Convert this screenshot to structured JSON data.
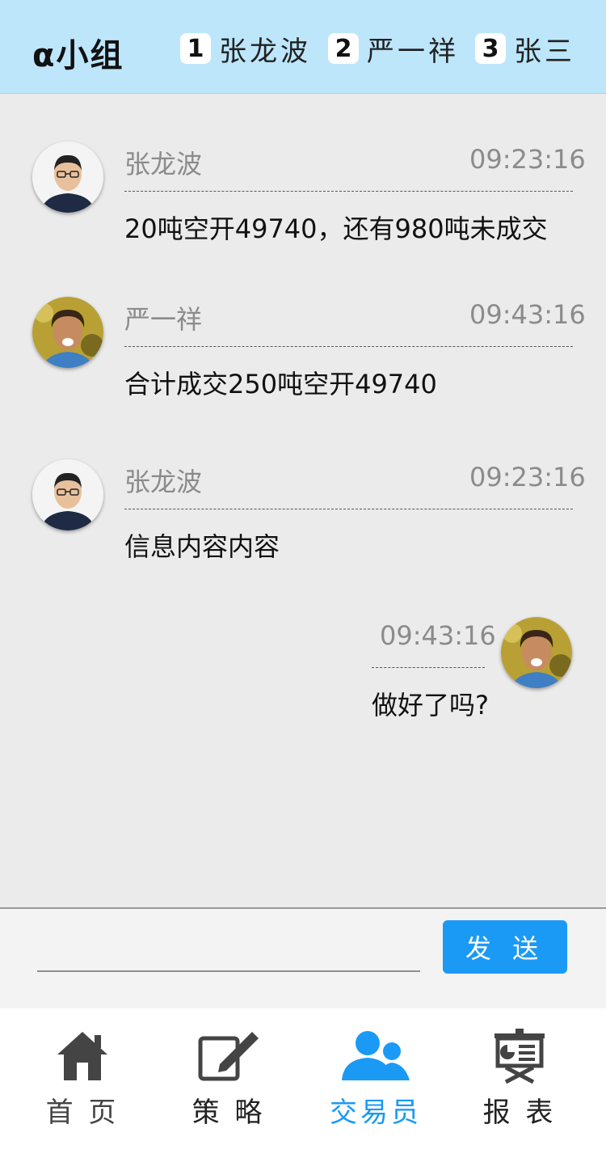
{
  "header": {
    "title": "α小组",
    "members": [
      {
        "rank": "1",
        "name": "张龙波"
      },
      {
        "rank": "2",
        "name": "严一祥"
      },
      {
        "rank": "3",
        "name": "张三"
      }
    ]
  },
  "messages": [
    {
      "sender": "张龙波",
      "time": "09:23:16",
      "text": "20吨空开49740，还有980吨未成交",
      "avatar": "asian-man-glasses"
    },
    {
      "sender": "严一祥",
      "time": "09:43:16",
      "text": "合计成交250吨空开49740",
      "avatar": "curly-hair-man"
    },
    {
      "sender": "张龙波",
      "time": "09:23:16",
      "text": "信息内容内容",
      "avatar": "asian-man-glasses"
    },
    {
      "sender": "",
      "time": "09:43:16",
      "text": "做好了吗?",
      "avatar": "curly-hair-man"
    }
  ],
  "composer": {
    "placeholder": "",
    "send_label": "发 送"
  },
  "tabs": [
    {
      "label": "首 页",
      "icon": "home-icon",
      "active": false
    },
    {
      "label": "策 略",
      "icon": "edit-icon",
      "active": false
    },
    {
      "label": "交易员",
      "icon": "traders-icon",
      "active": true
    },
    {
      "label": "报 表",
      "icon": "report-icon",
      "active": false
    }
  ],
  "colors": {
    "header_bg": "#bde6fb",
    "accent": "#1a9af5",
    "tab_inactive": "#444444",
    "chat_bg": "#ebebeb"
  }
}
